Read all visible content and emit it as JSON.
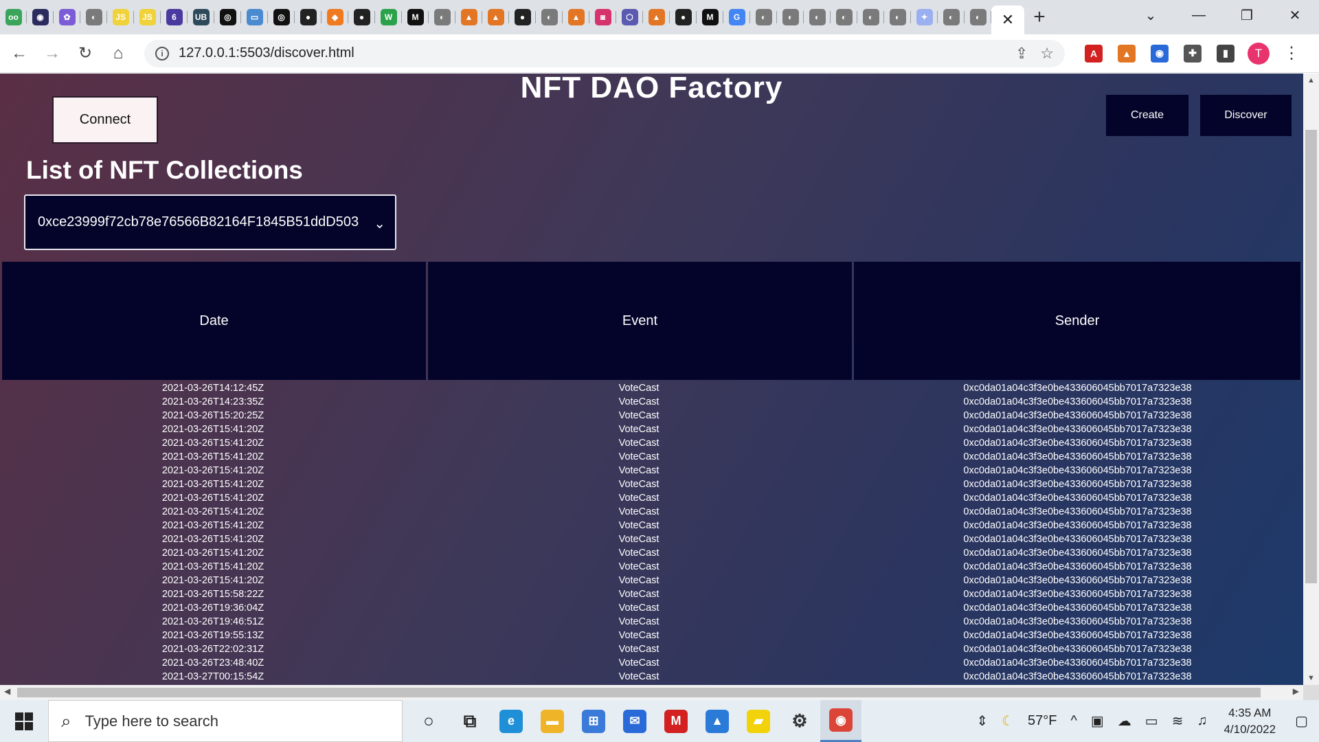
{
  "browser": {
    "tabs": [
      {
        "icon": "owl-icon",
        "color": "#3aa55a",
        "glyph": "oo"
      },
      {
        "icon": "circle-logo-icon",
        "color": "#2b2b5e",
        "glyph": "◉"
      },
      {
        "icon": "colorful-logo-icon",
        "color": "#7c5cd6",
        "glyph": "✿"
      },
      {
        "icon": "globe-icon",
        "color": "#7a7a7a",
        "glyph": "◐"
      },
      {
        "icon": "js-icon",
        "color": "#f0d23a",
        "glyph": "JS"
      },
      {
        "icon": "js-icon",
        "color": "#f0d23a",
        "glyph": "JS"
      },
      {
        "icon": "six-logo-icon",
        "color": "#4a3aa0",
        "glyph": "6"
      },
      {
        "icon": "ub-logo-icon",
        "color": "#2d4a5a",
        "glyph": "UB"
      },
      {
        "icon": "spiral-icon",
        "color": "#111",
        "glyph": "◎"
      },
      {
        "icon": "monitor-icon",
        "color": "#4a8ad0",
        "glyph": "▭"
      },
      {
        "icon": "spiral-icon",
        "color": "#111",
        "glyph": "◎"
      },
      {
        "icon": "github-icon",
        "color": "#222",
        "glyph": "●"
      },
      {
        "icon": "orange-logo-icon",
        "color": "#f07a20",
        "glyph": "◆"
      },
      {
        "icon": "github-icon",
        "color": "#222",
        "glyph": "●"
      },
      {
        "icon": "w-logo-icon",
        "color": "#2aa24a",
        "glyph": "W"
      },
      {
        "icon": "m-logo-icon",
        "color": "#111",
        "glyph": "M"
      },
      {
        "icon": "globe-icon",
        "color": "#7a7a7a",
        "glyph": "◐"
      },
      {
        "icon": "metamask-icon",
        "color": "#e27625",
        "glyph": "▲"
      },
      {
        "icon": "metamask-icon",
        "color": "#e27625",
        "glyph": "▲"
      },
      {
        "icon": "github-icon",
        "color": "#222",
        "glyph": "●"
      },
      {
        "icon": "globe-icon",
        "color": "#7a7a7a",
        "glyph": "◐"
      },
      {
        "icon": "metamask-icon",
        "color": "#e27625",
        "glyph": "▲"
      },
      {
        "icon": "instagram-icon",
        "color": "#d6336c",
        "glyph": "◙"
      },
      {
        "icon": "hex-logo-icon",
        "color": "#5a5ab0",
        "glyph": "⬡"
      },
      {
        "icon": "metamask-icon",
        "color": "#e27625",
        "glyph": "▲"
      },
      {
        "icon": "github-icon",
        "color": "#222",
        "glyph": "●"
      },
      {
        "icon": "m-logo-icon",
        "color": "#111",
        "glyph": "M"
      },
      {
        "icon": "google-icon",
        "color": "#4285f4",
        "glyph": "G"
      },
      {
        "icon": "globe-icon",
        "color": "#7a7a7a",
        "glyph": "◐"
      },
      {
        "icon": "globe-icon",
        "color": "#7a7a7a",
        "glyph": "◐"
      },
      {
        "icon": "globe-icon",
        "color": "#7a7a7a",
        "glyph": "◐"
      },
      {
        "icon": "globe-icon",
        "color": "#7a7a7a",
        "glyph": "◐"
      },
      {
        "icon": "globe-icon",
        "color": "#7a7a7a",
        "glyph": "◐"
      },
      {
        "icon": "globe-icon",
        "color": "#7a7a7a",
        "glyph": "◐"
      },
      {
        "icon": "sparkle-icon",
        "color": "#9ab0f0",
        "glyph": "✦"
      },
      {
        "icon": "globe-icon",
        "color": "#7a7a7a",
        "glyph": "◐"
      },
      {
        "icon": "globe-icon",
        "color": "#7a7a7a",
        "glyph": "◐"
      }
    ],
    "active_tab_close": "✕",
    "new_tab": "+",
    "window_controls": {
      "dropdown": "⌄",
      "minimize": "—",
      "restore": "❐",
      "close": "✕"
    },
    "url": "127.0.0.1:5503/discover.html",
    "extensions": [
      {
        "icon": "pdf-icon",
        "color": "#d32020",
        "glyph": "A"
      },
      {
        "icon": "metamask-icon",
        "color": "#e27625",
        "glyph": "▲"
      },
      {
        "icon": "screen-capture-icon",
        "color": "#2a6ad8",
        "glyph": "◉"
      },
      {
        "icon": "puzzle-icon",
        "color": "#555",
        "glyph": "✚"
      },
      {
        "icon": "side-panel-icon",
        "color": "#444",
        "glyph": "▮"
      }
    ],
    "avatar_letter": "T"
  },
  "page": {
    "title": "NFT DAO Factory",
    "connect_label": "Connect",
    "create_label": "Create",
    "discover_label": "Discover",
    "list_title": "List of NFT Collections",
    "selected_collection": "0xce23999f72cb78e76566B82164F1845B51ddD503",
    "table": {
      "headers": [
        "Date",
        "Event",
        "Sender"
      ],
      "rows": [
        [
          "2021-03-26T14:12:45Z",
          "VoteCast",
          "0xc0da01a04c3f3e0be433606045bb7017a7323e38"
        ],
        [
          "2021-03-26T14:23:35Z",
          "VoteCast",
          "0xc0da01a04c3f3e0be433606045bb7017a7323e38"
        ],
        [
          "2021-03-26T15:20:25Z",
          "VoteCast",
          "0xc0da01a04c3f3e0be433606045bb7017a7323e38"
        ],
        [
          "2021-03-26T15:41:20Z",
          "VoteCast",
          "0xc0da01a04c3f3e0be433606045bb7017a7323e38"
        ],
        [
          "2021-03-26T15:41:20Z",
          "VoteCast",
          "0xc0da01a04c3f3e0be433606045bb7017a7323e38"
        ],
        [
          "2021-03-26T15:41:20Z",
          "VoteCast",
          "0xc0da01a04c3f3e0be433606045bb7017a7323e38"
        ],
        [
          "2021-03-26T15:41:20Z",
          "VoteCast",
          "0xc0da01a04c3f3e0be433606045bb7017a7323e38"
        ],
        [
          "2021-03-26T15:41:20Z",
          "VoteCast",
          "0xc0da01a04c3f3e0be433606045bb7017a7323e38"
        ],
        [
          "2021-03-26T15:41:20Z",
          "VoteCast",
          "0xc0da01a04c3f3e0be433606045bb7017a7323e38"
        ],
        [
          "2021-03-26T15:41:20Z",
          "VoteCast",
          "0xc0da01a04c3f3e0be433606045bb7017a7323e38"
        ],
        [
          "2021-03-26T15:41:20Z",
          "VoteCast",
          "0xc0da01a04c3f3e0be433606045bb7017a7323e38"
        ],
        [
          "2021-03-26T15:41:20Z",
          "VoteCast",
          "0xc0da01a04c3f3e0be433606045bb7017a7323e38"
        ],
        [
          "2021-03-26T15:41:20Z",
          "VoteCast",
          "0xc0da01a04c3f3e0be433606045bb7017a7323e38"
        ],
        [
          "2021-03-26T15:41:20Z",
          "VoteCast",
          "0xc0da01a04c3f3e0be433606045bb7017a7323e38"
        ],
        [
          "2021-03-26T15:41:20Z",
          "VoteCast",
          "0xc0da01a04c3f3e0be433606045bb7017a7323e38"
        ],
        [
          "2021-03-26T15:58:22Z",
          "VoteCast",
          "0xc0da01a04c3f3e0be433606045bb7017a7323e38"
        ],
        [
          "2021-03-26T19:36:04Z",
          "VoteCast",
          "0xc0da01a04c3f3e0be433606045bb7017a7323e38"
        ],
        [
          "2021-03-26T19:46:51Z",
          "VoteCast",
          "0xc0da01a04c3f3e0be433606045bb7017a7323e38"
        ],
        [
          "2021-03-26T19:55:13Z",
          "VoteCast",
          "0xc0da01a04c3f3e0be433606045bb7017a7323e38"
        ],
        [
          "2021-03-26T22:02:31Z",
          "VoteCast",
          "0xc0da01a04c3f3e0be433606045bb7017a7323e38"
        ],
        [
          "2021-03-26T23:48:40Z",
          "VoteCast",
          "0xc0da01a04c3f3e0be433606045bb7017a7323e38"
        ],
        [
          "2021-03-27T00:15:54Z",
          "VoteCast",
          "0xc0da01a04c3f3e0be433606045bb7017a7323e38"
        ]
      ]
    },
    "colors": {
      "button_dark": "#04042a",
      "accent_avatar": "#e8336d"
    }
  },
  "taskbar": {
    "search_placeholder": "Type here to search",
    "apps": [
      {
        "name": "cortana-circle-icon",
        "color": "#222",
        "glyph": "○"
      },
      {
        "name": "task-view-icon",
        "color": "#222",
        "glyph": "⧉"
      },
      {
        "name": "edge-icon",
        "color": "#1f8fd8",
        "glyph": "e"
      },
      {
        "name": "file-explorer-icon",
        "color": "#f0b429",
        "glyph": "▬"
      },
      {
        "name": "store-icon",
        "color": "#3a7ad8",
        "glyph": "⊞"
      },
      {
        "name": "mail-icon",
        "color": "#2a6ad8",
        "glyph": "✉"
      },
      {
        "name": "mcafee-icon",
        "color": "#d32020",
        "glyph": "M"
      },
      {
        "name": "photos-icon",
        "color": "#2a7ad8",
        "glyph": "▲"
      },
      {
        "name": "sticky-notes-icon",
        "color": "#f2d20a",
        "glyph": "▰"
      },
      {
        "name": "settings-icon",
        "color": "#333",
        "glyph": "⚙"
      },
      {
        "name": "chrome-icon",
        "color": "#db4437",
        "glyph": "◉"
      }
    ],
    "weather_temp": "57°F",
    "time": "4:35 AM",
    "date": "4/10/2022"
  }
}
